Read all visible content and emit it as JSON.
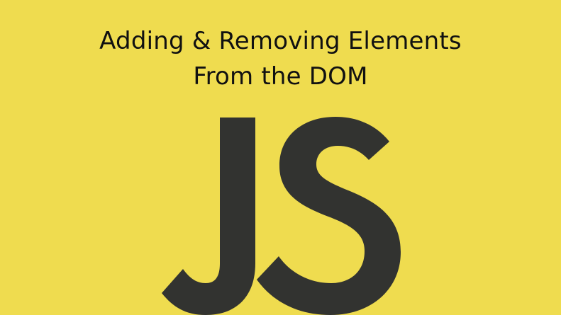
{
  "colors": {
    "background": "#efdc4f",
    "title_text": "#111111",
    "logo_text": "#323330"
  },
  "title": {
    "line1": "Adding & Removing Elements",
    "line2": "From the DOM"
  },
  "logo": {
    "text": "JS",
    "icon": "javascript-logo"
  }
}
